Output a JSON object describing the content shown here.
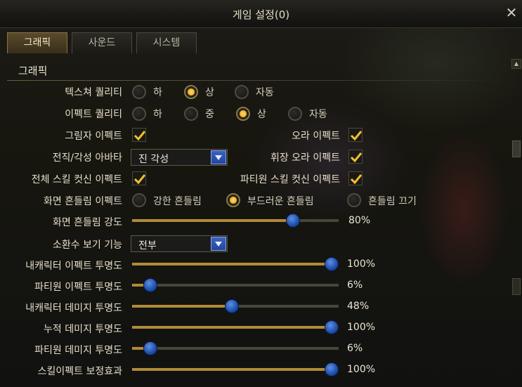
{
  "window": {
    "title": "게임 설정(0)",
    "close_glyph": "✕"
  },
  "tabs": [
    {
      "label": "그래픽",
      "active": true
    },
    {
      "label": "사운드",
      "active": false
    },
    {
      "label": "시스템",
      "active": false
    }
  ],
  "section": {
    "title": "그래픽"
  },
  "texture_quality": {
    "label": "텍스쳐 퀄리티",
    "options": [
      "하",
      "상",
      "자동"
    ],
    "selected": "상"
  },
  "effect_quality": {
    "label": "이펙트 퀄리티",
    "options": [
      "하",
      "중",
      "상",
      "자동"
    ],
    "selected": "상"
  },
  "shadow_effect": {
    "label": "그림자 이펙트",
    "checked": true
  },
  "aura_effect": {
    "label": "오라 이펙트",
    "checked": true
  },
  "avatar": {
    "label": "전직/각성 아바타",
    "value": "진 각성"
  },
  "title_aura": {
    "label": "휘장 오라 이펙트",
    "checked": true
  },
  "all_skill_cutin": {
    "label": "전체 스킬 컷신 이펙트",
    "checked": true
  },
  "party_skill_cutin": {
    "label": "파티원 스킬 컷신 이펙트",
    "checked": true
  },
  "screen_shake": {
    "label": "화면 흔들림 이펙트",
    "options": [
      "강한 흔들림",
      "부드러운 흔들림",
      "흔들림 끄기"
    ],
    "selected": "부드러운 흔들림"
  },
  "shake_strength": {
    "label": "화면 흔들림 강도",
    "value": 80,
    "display": "80%"
  },
  "summon_view": {
    "label": "소환수 보기 기능",
    "value": "전부"
  },
  "my_effect_opacity": {
    "label": "내캐릭터 이펙트 투명도",
    "value": 100,
    "display": "100%"
  },
  "party_effect_opacity": {
    "label": "파티원 이펙트 투명도",
    "value": 6,
    "display": "6%"
  },
  "my_damage_opacity": {
    "label": "내캐릭터 데미지 투명도",
    "value": 48,
    "display": "48%"
  },
  "cumulative_damage_opacity": {
    "label": "누적 데미지 투명도",
    "value": 100,
    "display": "100%"
  },
  "party_damage_opacity": {
    "label": "파티원 데미지 투명도",
    "value": 6,
    "display": "6%"
  },
  "skill_effect_correction": {
    "label": "스킬이펙트 보정효과",
    "value": 100,
    "display": "100%"
  },
  "icons": {
    "close": "close-icon",
    "scroll_up": "scroll-up-icon",
    "checkmark": "checkmark-icon",
    "dropdown": "chevron-down-icon"
  },
  "colors": {
    "accent_gold": "#f3b42c",
    "slider_fill": "#b08a38",
    "slider_thumb": "#1c4fae",
    "dropdown_button": "#2346a0",
    "checkmark": "#f0c030"
  }
}
